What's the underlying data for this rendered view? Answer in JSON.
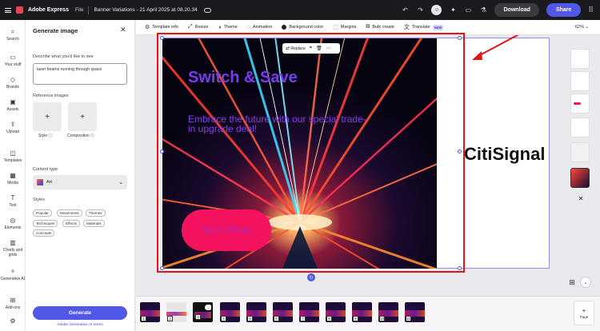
{
  "app": {
    "name": "Adobe Express",
    "file_menu": "File",
    "doc_title": "Banner Variations - 21 April 2025 at 08.20.34",
    "download": "Download",
    "share": "Share",
    "brand_color": "#5158e8"
  },
  "left_rail": {
    "items": [
      {
        "label": "Search",
        "icon": "search-icon"
      },
      {
        "label": "Your stuff",
        "icon": "folder-icon"
      },
      {
        "label": "Brands",
        "icon": "brand-icon"
      },
      {
        "label": "Assets",
        "icon": "assets-icon"
      },
      {
        "label": "Upload",
        "icon": "upload-icon"
      },
      {
        "label": "Templates",
        "icon": "templates-icon"
      },
      {
        "label": "Media",
        "icon": "media-icon"
      },
      {
        "label": "Text",
        "icon": "text-icon"
      },
      {
        "label": "Elements",
        "icon": "elements-icon"
      },
      {
        "label": "Charts and grids",
        "icon": "charts-icon"
      },
      {
        "label": "Generative AI",
        "icon": "generative-ai-icon"
      },
      {
        "label": "Add-ons",
        "icon": "addons-icon"
      }
    ]
  },
  "panel": {
    "title": "Generate image",
    "describe_label": "Describe what you'd like to see",
    "prompt_value": "laser beams running through space",
    "ref_label": "Reference images",
    "style_label": "Style",
    "composition_label": "Composition",
    "content_type_label": "Content type",
    "content_type_value": "Art",
    "styles_label": "Styles",
    "style_chips": [
      "Popular",
      "Movements",
      "Themes",
      "Techniques",
      "Effects",
      "Materials",
      "Concepts"
    ],
    "generate_button": "Generate",
    "terms_link": "Adobe Generative AI terms"
  },
  "toolbar": {
    "items": [
      {
        "label": "Template info",
        "icon": "template-info-icon"
      },
      {
        "label": "Resize",
        "icon": "resize-icon"
      },
      {
        "label": "Theme",
        "icon": "theme-icon"
      },
      {
        "label": "Animation",
        "icon": "animation-icon"
      },
      {
        "label": "Background color",
        "icon": "background-color-icon"
      },
      {
        "label": "Margins",
        "icon": "margins-icon"
      },
      {
        "label": "Bulk create",
        "icon": "bulk-create-icon"
      },
      {
        "label": "Translate",
        "icon": "translate-icon"
      }
    ],
    "new_badge": "NEW",
    "zoom": "62%"
  },
  "canvas": {
    "context_replace": "Replace",
    "headline": "Switch & Save",
    "subline": "Embrace the future with our special trade-in upgrade deal!",
    "cta": "SHOP DETAILS",
    "brand": "CitiSignal"
  },
  "pages": {
    "numbers": [
      "1",
      "2",
      "3",
      "4",
      "5",
      "6",
      "7",
      "8",
      "9",
      "10",
      "11"
    ],
    "selected": 3,
    "add_label": "Page",
    "more_label": "..."
  }
}
